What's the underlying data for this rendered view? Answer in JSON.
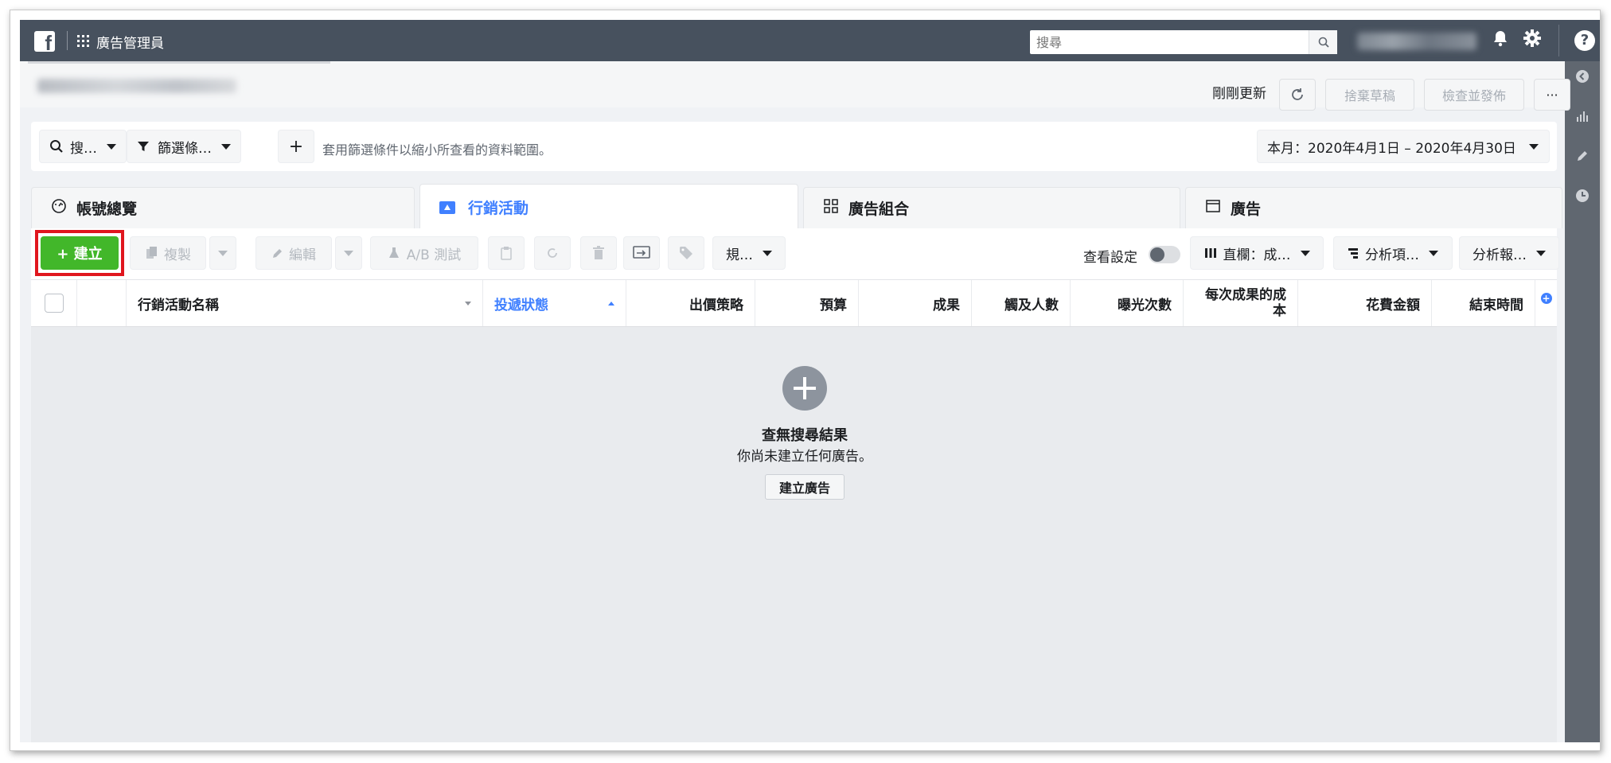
{
  "topbar": {
    "logo": "f",
    "app_title": "廣告管理員",
    "search_placeholder": "搜尋",
    "icons": [
      "grid-icon",
      "search-icon",
      "bell-icon",
      "gear-icon",
      "help-icon"
    ],
    "help_label": "?"
  },
  "account_bar": {
    "updated_label": "剛剛更新",
    "discard_label": "捨棄草稿",
    "review_label": "檢查並發佈",
    "more_label": "···"
  },
  "filter_bar": {
    "search_label": "搜…",
    "filter_label": "篩選條…",
    "add_label": "+",
    "hint": "套用篩選條件以縮小所查看的資料範圍。",
    "date_range": "本月：2020年4月1日 – 2020年4月30日"
  },
  "tabs": [
    {
      "label": "帳號總覽",
      "icon": "gauge-icon",
      "active": false
    },
    {
      "label": "行銷活動",
      "icon": "folder-icon",
      "active": true
    },
    {
      "label": "廣告組合",
      "icon": "grid-squares-icon",
      "active": false
    },
    {
      "label": "廣告",
      "icon": "window-icon",
      "active": false
    }
  ],
  "toolbar": {
    "create_label": "+ 建立",
    "duplicate_label": "複製",
    "edit_label": "編輯",
    "ab_test_label": "A/B 測試",
    "rules_label": "規…",
    "view_setup_label": "查看設定",
    "columns_label": "直欄：成…",
    "breakdown_label": "分析項…",
    "reports_label": "分析報…"
  },
  "table": {
    "columns": [
      "行銷活動名稱",
      "投遞狀態",
      "出價策略",
      "預算",
      "成果",
      "觸及人數",
      "曝光次數",
      "每次成果的成本",
      "花費金額",
      "結束時間"
    ],
    "sorted_column": "投遞狀態"
  },
  "empty_state": {
    "title": "查無搜尋結果",
    "subtitle": "你尚未建立任何廣告。",
    "button": "建立廣告"
  },
  "colors": {
    "topbar": "#47515e",
    "accent": "#4080ff",
    "create_green": "#42b72a",
    "highlight_red": "#e0161e"
  }
}
